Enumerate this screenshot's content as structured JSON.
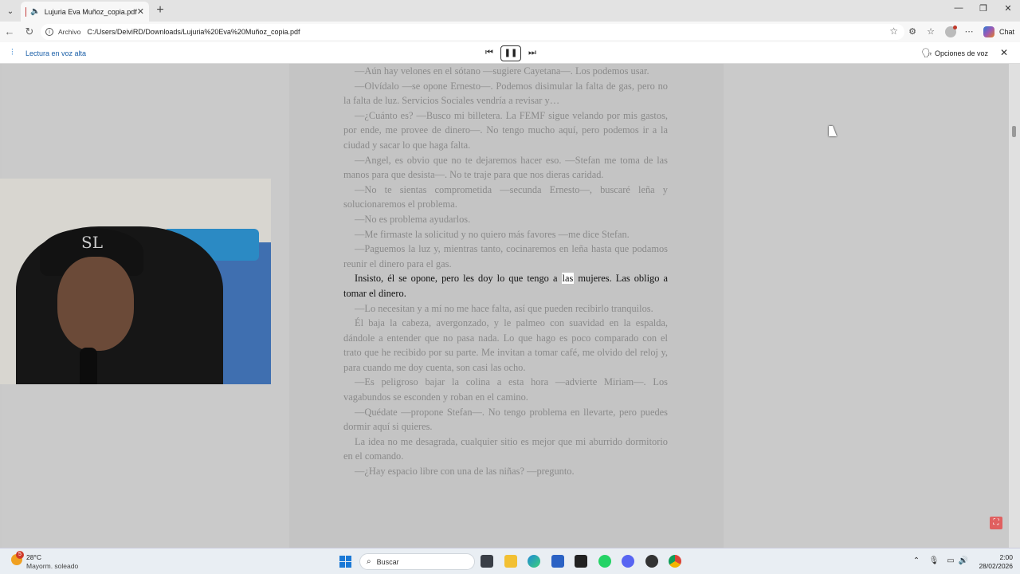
{
  "browser": {
    "tab_title": "Lujuria Eva Muñoz_copia.pdf",
    "new_tab_symbol": "+",
    "address_label": "Archivo",
    "address_url": "C:/Users/DeiviRD/Downloads/Lujuria%20Eva%20Muñoz_copia.pdf",
    "chat_label": "Chat"
  },
  "read_aloud": {
    "title": "Lectura en voz alta",
    "voice_options": "Opciones de voz"
  },
  "document": {
    "paragraphs": [
      "—Aún hay velones en el sótano —sugiere Cayetana—. Los podemos usar.",
      "—Olvídalo —se opone Ernesto—. Podemos disimular la falta de gas, pero no la falta de luz. Servicios Sociales vendría a revisar y…",
      "—¿Cuánto es? —Busco mi billetera. La FEMF sigue velando por mis gastos, por ende, me provee de dinero—. No tengo mucho aquí, pero podemos ir a la ciudad y sacar lo que haga falta.",
      "—Angel, es obvio que no te dejaremos hacer eso. —Stefan me toma de las manos para que desista—. No te traje para que nos dieras caridad.",
      "—No te sientas comprometida —secunda Ernesto—, buscaré leña y solucionaremos el problema.",
      "—No es problema ayudarlos.",
      "—Me firmaste la solicitud y no quiero más favores —me dice Stefan.",
      "—Paguemos la luz y, mientras tanto, cocinaremos en leña hasta que podamos reunir el dinero para el gas."
    ],
    "active_before": "Insisto, él se opone, pero les doy lo que tengo a ",
    "active_highlight": "las",
    "active_after": " mujeres. Las obligo a tomar el dinero.",
    "paragraphs_after": [
      "—Lo necesitan y a mí no me hace falta, así que pueden recibirlo tranquilos.",
      "Él baja la cabeza, avergonzado, y le palmeo con suavidad en la espalda, dándole a entender que no pasa nada. Lo que hago es poco comparado con el trato que he recibido por su parte. Me invitan a tomar café, me olvido del reloj y, para cuando me doy cuenta, son casi las ocho.",
      "—Es peligroso bajar la colina a esta hora —advierte Miriam—. Los vagabundos se esconden y roban en el camino.",
      "—Quédate —propone Stefan—. No tengo problema en llevarte, pero puedes dormir aquí si quieres.",
      "La idea no me desagrada, cualquier sitio es mejor que mi aburrido dormitorio en el comando.",
      "—¿Hay espacio libre con una de las niñas? —pregunto."
    ]
  },
  "taskbar": {
    "weather_badge": "5",
    "weather_temp": "28°C",
    "weather_desc": "Mayorm. soleado",
    "search_placeholder": "Buscar",
    "time": "2:00",
    "date": "28/02/2026"
  },
  "webcam": {
    "cap_logo": "SL"
  }
}
